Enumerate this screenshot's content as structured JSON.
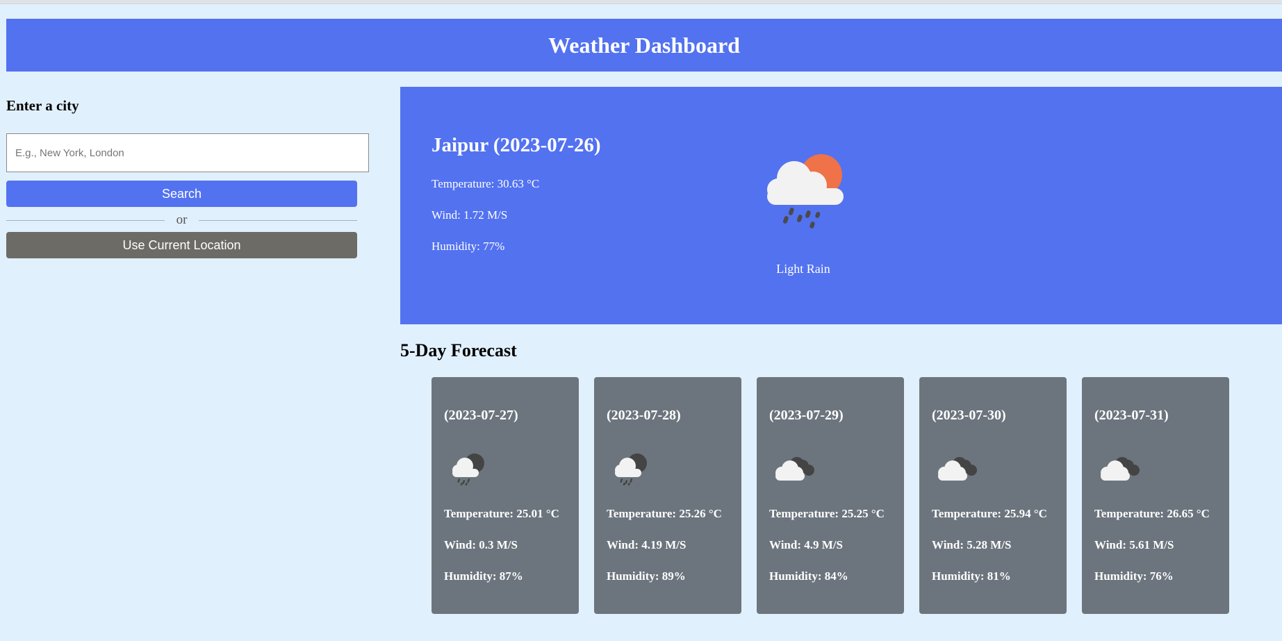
{
  "app": {
    "title": "Weather Dashboard"
  },
  "search": {
    "heading": "Enter a city",
    "placeholder": "E.g., New York, London",
    "value": "",
    "search_label": "Search",
    "separator": "or",
    "location_label": "Use Current Location"
  },
  "current": {
    "title": "Jaipur (2023-07-26)",
    "temperature": "Temperature: 30.63 °C",
    "wind": "Wind: 1.72 M/S",
    "humidity": "Humidity: 77%",
    "icon": "light-rain-sun-icon",
    "description": "Light Rain"
  },
  "forecast": {
    "title": "5-Day Forecast",
    "days": [
      {
        "date": "(2023-07-27)",
        "icon": "rain-cloud-icon",
        "temperature": "Temperature: 25.01 °C",
        "wind": "Wind: 0.3 M/S",
        "humidity": "Humidity: 87%"
      },
      {
        "date": "(2023-07-28)",
        "icon": "rain-cloud-icon",
        "temperature": "Temperature: 25.26 °C",
        "wind": "Wind: 4.19 M/S",
        "humidity": "Humidity: 89%"
      },
      {
        "date": "(2023-07-29)",
        "icon": "overcast-clouds-icon",
        "temperature": "Temperature: 25.25 °C",
        "wind": "Wind: 4.9 M/S",
        "humidity": "Humidity: 84%"
      },
      {
        "date": "(2023-07-30)",
        "icon": "overcast-clouds-icon",
        "temperature": "Temperature: 25.94 °C",
        "wind": "Wind: 5.28 M/S",
        "humidity": "Humidity: 81%"
      },
      {
        "date": "(2023-07-31)",
        "icon": "overcast-clouds-icon",
        "temperature": "Temperature: 26.65 °C",
        "wind": "Wind: 5.61 M/S",
        "humidity": "Humidity: 76%"
      }
    ]
  },
  "colors": {
    "background": "#e1f0fd",
    "accent": "#5372f0",
    "card": "#6c757d",
    "location_button": "#6c6b66",
    "sun": "#ef7248"
  }
}
